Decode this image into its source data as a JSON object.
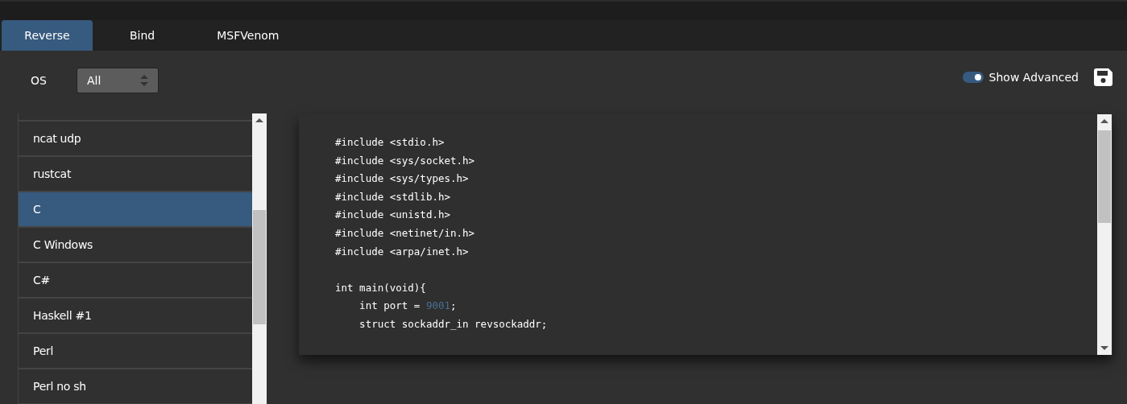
{
  "tabs": [
    {
      "label": "Reverse",
      "selected": true
    },
    {
      "label": "Bind",
      "selected": false
    },
    {
      "label": "MSFVenom",
      "selected": false
    }
  ],
  "os": {
    "label": "OS",
    "value": "All"
  },
  "show_advanced": {
    "label": "Show Advanced",
    "on": true
  },
  "shells": [
    {
      "label": "ncat udp",
      "selected": false
    },
    {
      "label": "rustcat",
      "selected": false
    },
    {
      "label": "C",
      "selected": true
    },
    {
      "label": "C Windows",
      "selected": false
    },
    {
      "label": "C#",
      "selected": false
    },
    {
      "label": "Haskell #1",
      "selected": false
    },
    {
      "label": "Perl",
      "selected": false
    },
    {
      "label": "Perl no sh",
      "selected": false
    }
  ],
  "code_blocks": [
    [
      [
        {
          "kind": "plain",
          "text": "#include <stdio.h>"
        }
      ],
      [
        {
          "kind": "plain",
          "text": "#include <sys/socket.h>"
        }
      ],
      [
        {
          "kind": "plain",
          "text": "#include <sys/types.h>"
        }
      ],
      [
        {
          "kind": "plain",
          "text": "#include <stdlib.h>"
        }
      ],
      [
        {
          "kind": "plain",
          "text": "#include <unistd.h>"
        }
      ],
      [
        {
          "kind": "plain",
          "text": "#include <netinet/in.h>"
        }
      ],
      [
        {
          "kind": "plain",
          "text": "#include <arpa/inet.h>"
        }
      ]
    ],
    [
      [
        {
          "kind": "plain",
          "text": "int main(void){"
        }
      ],
      [
        {
          "kind": "plain",
          "text": "    int port = "
        },
        {
          "kind": "number",
          "text": "9001"
        },
        {
          "kind": "plain",
          "text": ";"
        }
      ],
      [
        {
          "kind": "plain",
          "text": "    struct sockaddr_in revsockaddr;"
        }
      ]
    ]
  ]
}
